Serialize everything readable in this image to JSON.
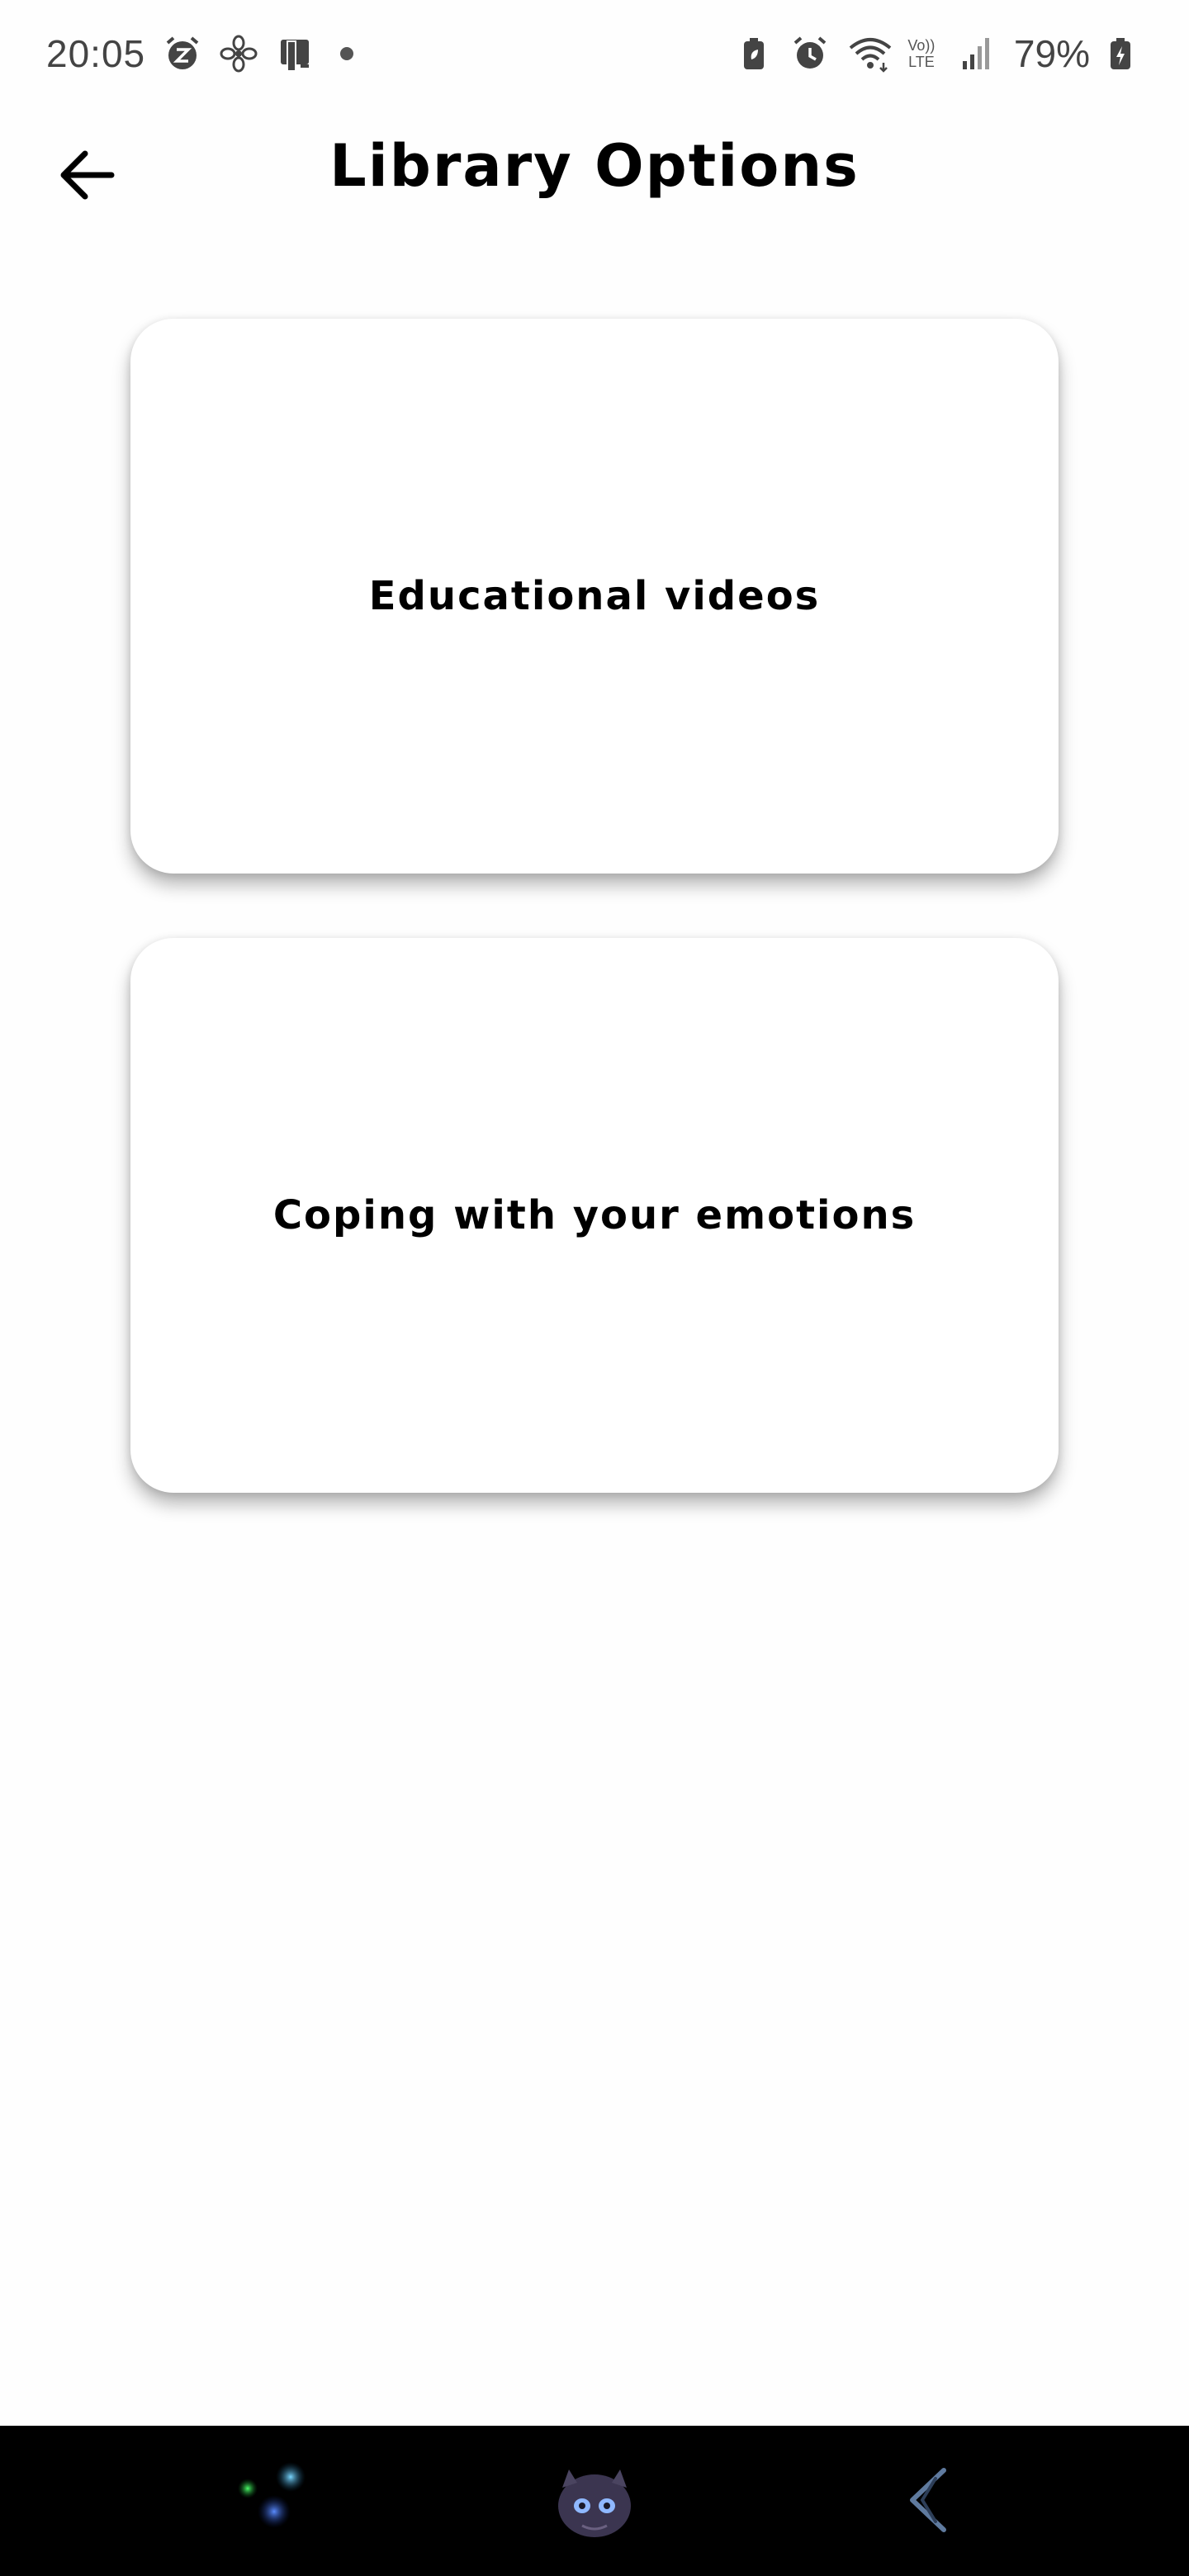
{
  "status_bar": {
    "time": "20:05",
    "battery_percent": "79%",
    "network_label_top": "Vo))",
    "network_label_bottom": "LTE",
    "icons": [
      "alarm-snooze-icon",
      "fan-icon",
      "device-icon",
      "notification-dot",
      "battery-saver-icon",
      "alarm-icon",
      "wifi-icon",
      "volte-icon",
      "signal-icon",
      "battery-charging-icon"
    ]
  },
  "header": {
    "title": "Library Options",
    "back_icon": "arrow-left-icon"
  },
  "cards": [
    {
      "label": "Educational videos"
    },
    {
      "label": "Coping with your emotions"
    }
  ],
  "nav_bar": {
    "items": [
      "recents-icon",
      "home-icon",
      "back-icon"
    ],
    "background": "#000000"
  },
  "colors": {
    "background": "#fefefe",
    "text": "#000000",
    "card": "#ffffff"
  }
}
